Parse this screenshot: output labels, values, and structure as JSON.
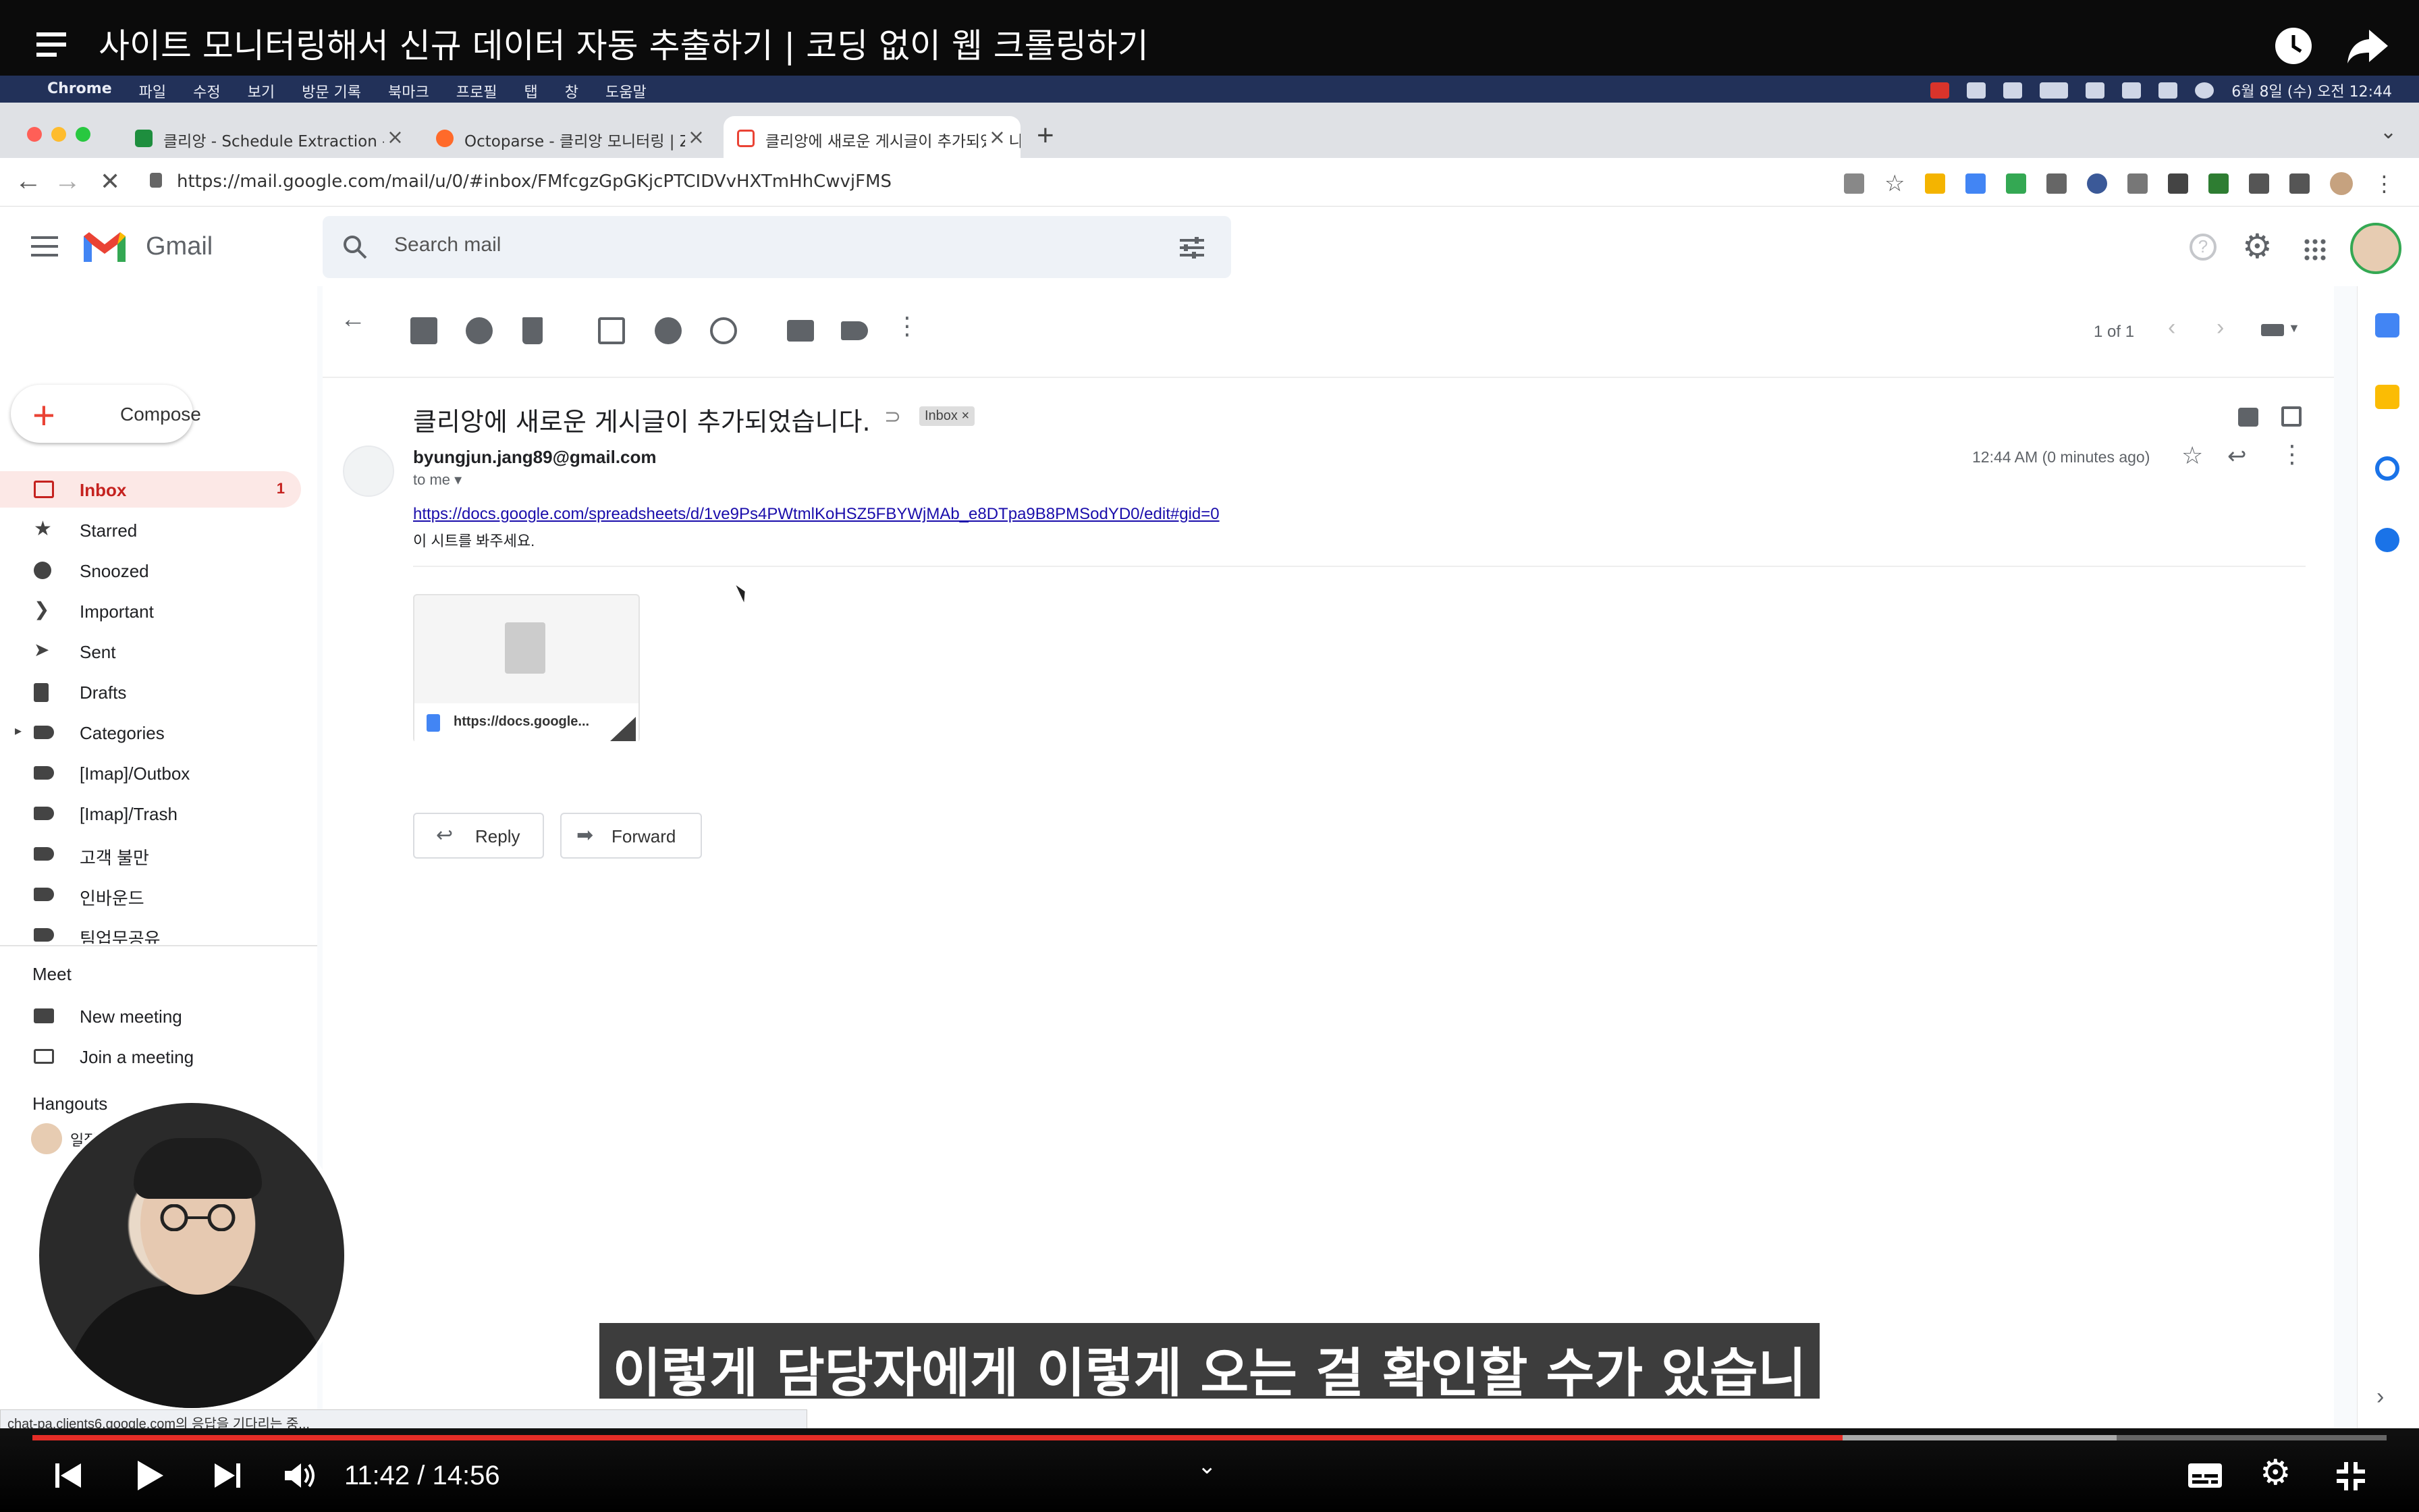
{
  "video": {
    "title": "사이트 모니터링해서 신규 데이터 자동 추출하기 | 코딩 없이 웹 크롤링하기",
    "subtitle": "이렇게 담당자에게 이렇게 오는 걸 확인할 수가 있습니다",
    "time_current": "11:42",
    "time_total": "14:56",
    "time_display": "11:42 / 14:56",
    "progress_fraction": 0.78
  },
  "menubar": {
    "app": "Chrome",
    "menus": [
      "파일",
      "수정",
      "보기",
      "방문 기록",
      "북마크",
      "프로필",
      "탭",
      "창",
      "도움말"
    ],
    "clock": "6월 8일 (수) 오전 12:44"
  },
  "tabs": [
    {
      "label": "클리앙 - Schedule Extraction - G",
      "color": "#1e8e3e"
    },
    {
      "label": "Octoparse - 클리앙 모니터링 | Za",
      "color": "#ff6a2a"
    },
    {
      "label": "클리앙에 새로운 게시글이 추가되었습니다",
      "color": "#ea4335"
    }
  ],
  "address_bar": {
    "url": "https://mail.google.com/mail/u/0/#inbox/FMfcgzGpGKjcPTCIDVvHXTmHhCwvjFMS"
  },
  "gmail": {
    "brand": "Gmail",
    "search_placeholder": "Search mail",
    "compose_label": "Compose",
    "pager": "1 of 1",
    "sidebar_items": [
      {
        "label": "Inbox",
        "count": "1",
        "icon": "inbox-icon"
      },
      {
        "label": "Starred",
        "count": "",
        "icon": "star-icon"
      },
      {
        "label": "Snoozed",
        "count": "",
        "icon": "clock-icon"
      },
      {
        "label": "Important",
        "count": "",
        "icon": "important-icon"
      },
      {
        "label": "Sent",
        "count": "",
        "icon": "send-icon"
      },
      {
        "label": "Drafts",
        "count": "",
        "icon": "draft-icon"
      },
      {
        "label": "Categories",
        "count": "",
        "icon": "label-icon"
      },
      {
        "label": "[Imap]/Outbox",
        "count": "",
        "icon": "label-icon"
      },
      {
        "label": "[Imap]/Trash",
        "count": "",
        "icon": "label-icon"
      },
      {
        "label": "고객 불만",
        "count": "",
        "icon": "label-icon"
      },
      {
        "label": "인바운드",
        "count": "",
        "icon": "label-icon"
      },
      {
        "label": "팀업무공유",
        "count": "",
        "icon": "label-icon"
      }
    ],
    "meet": {
      "title": "Meet",
      "new_meeting": "New meeting",
      "join_meeting": "Join a meeting"
    },
    "hangouts": {
      "title": "Hangouts",
      "user": "일잘러 장피엠"
    },
    "email": {
      "subject": "클리앙에 새로운 게시글이 추가되었습니다.",
      "label_chip": "Inbox",
      "sender": "byungjun.jang89@gmail.com",
      "to": "to me",
      "time": "12:44 AM (0 minutes ago)",
      "link": "https://docs.google.com/spreadsheets/d/1ve9Ps4PWtmlKoHSZ5FBYWjMAb_e8DTpa9B8PMSodYD0/edit#gid=0",
      "body": "이 시트를 봐주세요.",
      "attachment_name": "https://docs.google...",
      "reply_label": "Reply",
      "forward_label": "Forward"
    }
  },
  "status_bar_text": "chat-pa.clients6.google.com의 응답을 기다리는 중...",
  "colors": {
    "inbox_active_bg": "#fce8e6",
    "inbox_active_text": "#c5221f",
    "progress": "#e52d27",
    "menubar": "#223159"
  }
}
